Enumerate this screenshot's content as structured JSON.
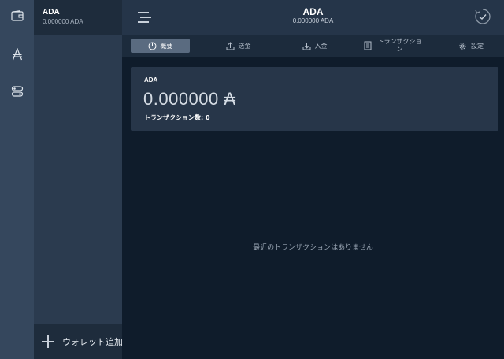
{
  "rail": {
    "items": [
      {
        "icon": "wallet-icon"
      },
      {
        "icon": "ada-symbol-icon"
      },
      {
        "icon": "settings-toggle-icon"
      }
    ]
  },
  "wallets": {
    "items": [
      {
        "name": "ADA",
        "amount": "0.000000 ADA"
      }
    ],
    "add_label": "ウォレット追加"
  },
  "header": {
    "title": "ADA",
    "subtitle": "0.000000 ADA"
  },
  "tabs": [
    {
      "label": "概要",
      "icon": "summary-icon",
      "active": true
    },
    {
      "label": "送金",
      "icon": "send-icon",
      "active": false
    },
    {
      "label": "入金",
      "icon": "receive-icon",
      "active": false
    },
    {
      "label": "トランザクション",
      "icon": "transactions-icon",
      "active": false
    },
    {
      "label": "設定",
      "icon": "gear-icon",
      "active": false
    }
  ],
  "summary": {
    "wallet_name": "ADA",
    "amount": "0.000000",
    "currency_symbol": "₳",
    "tx_count": "トランザクション数: 0"
  },
  "empty_message": "最近のトランザクションはありません",
  "colors": {
    "rail_bg": "#35475d",
    "sidebar_bg": "#2b3b4f",
    "main_bg": "#0f1c2b",
    "topbar_bg": "#253549",
    "card_bg": "#273649",
    "active_tab_bg": "#5a6b80"
  }
}
